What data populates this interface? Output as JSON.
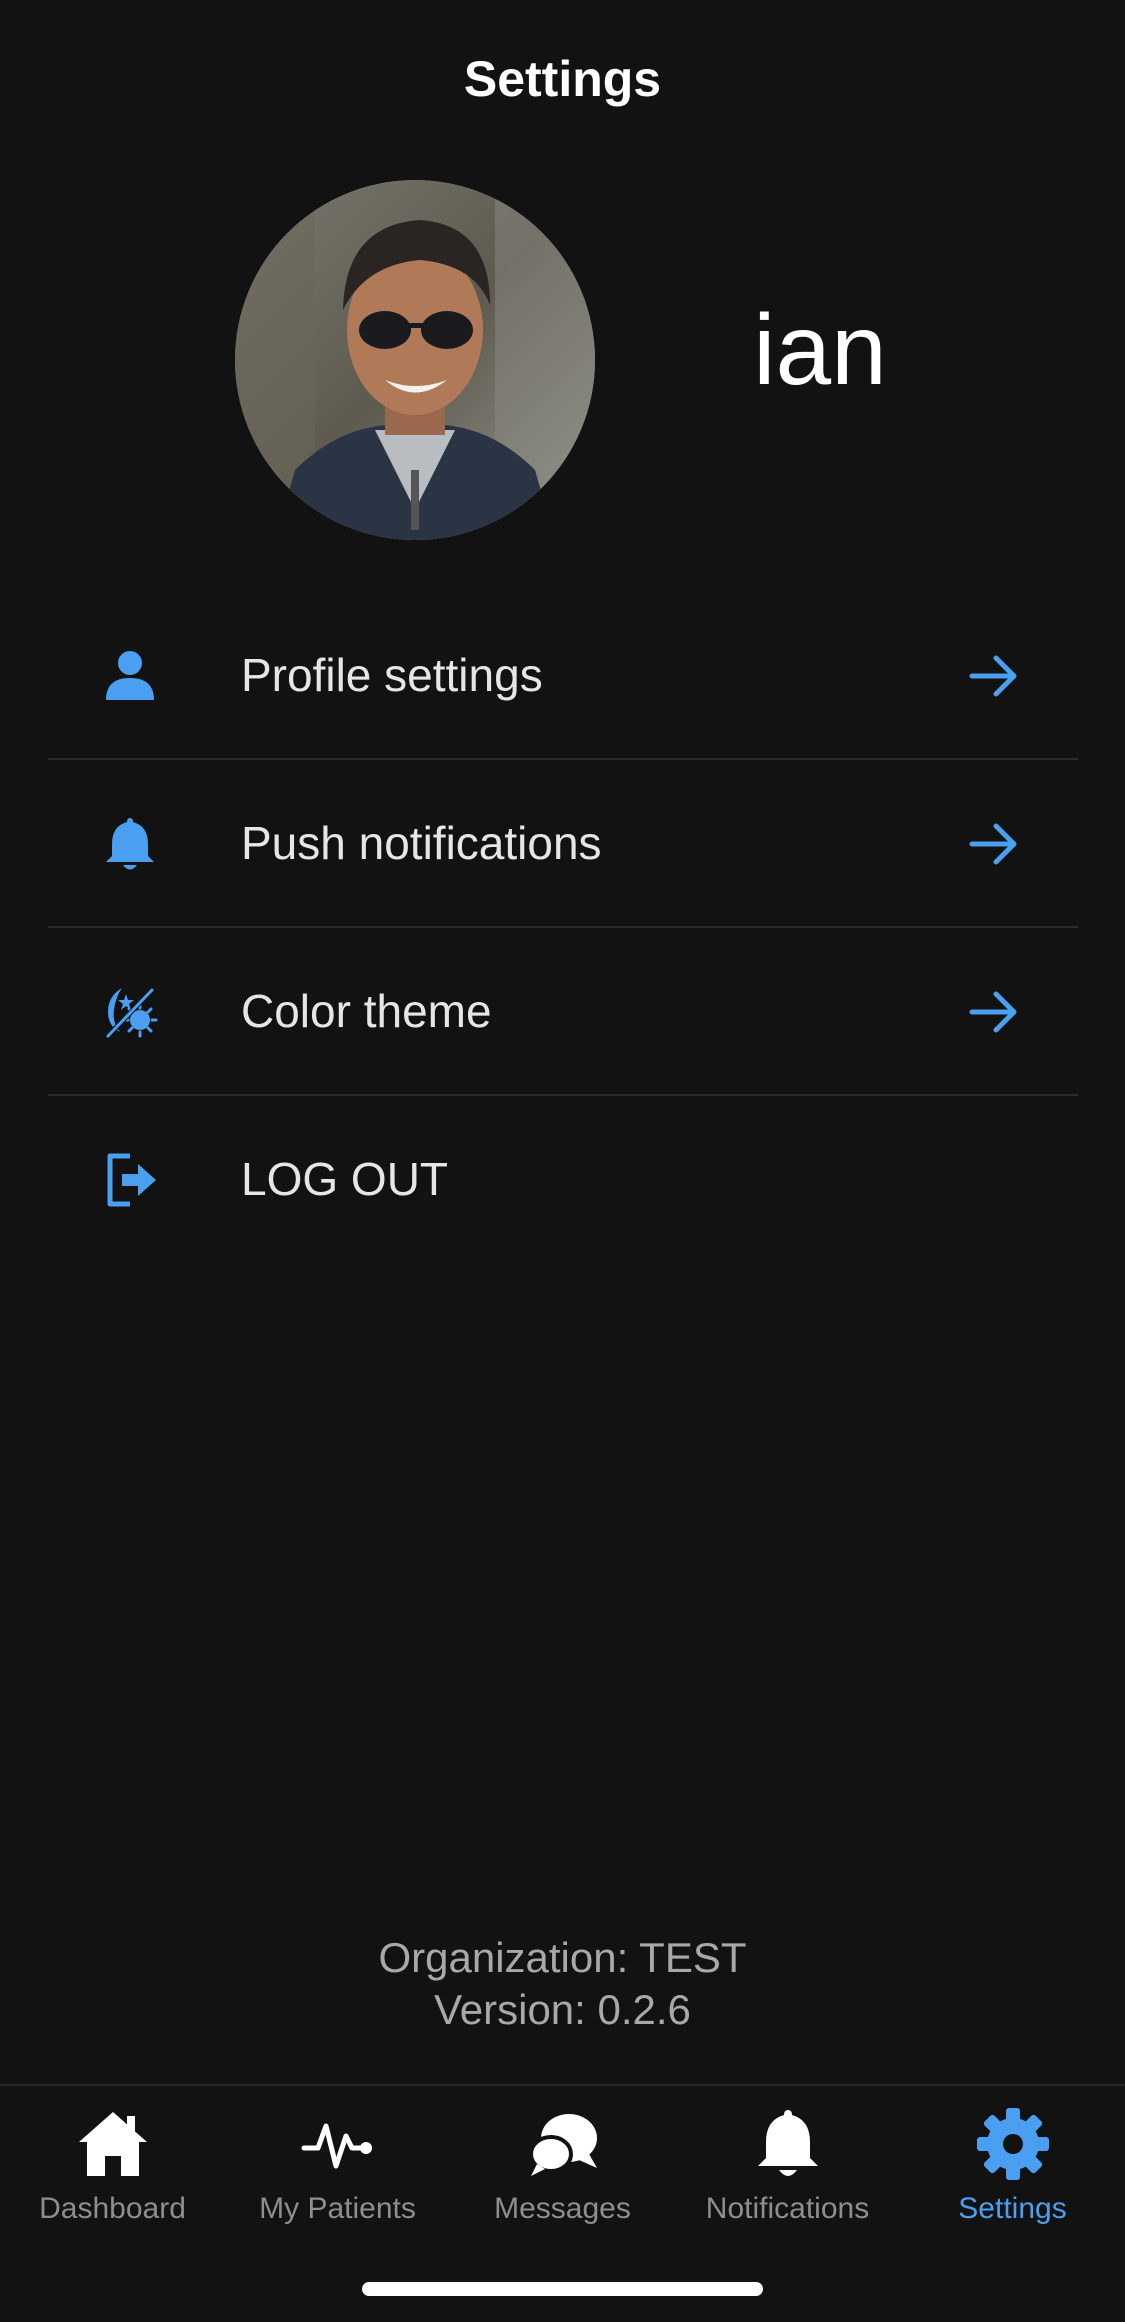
{
  "header": {
    "title": "Settings"
  },
  "profile": {
    "name": "ian"
  },
  "menu": {
    "items": [
      {
        "label": "Profile settings",
        "icon": "person-icon"
      },
      {
        "label": "Push notifications",
        "icon": "bell-icon"
      },
      {
        "label": "Color theme",
        "icon": "theme-icon"
      },
      {
        "label": "LOG OUT",
        "icon": "logout-icon"
      }
    ]
  },
  "footer": {
    "organization": "Organization: TEST",
    "version": "Version: 0.2.6"
  },
  "tabbar": {
    "tabs": [
      {
        "label": "Dashboard",
        "icon": "home-icon",
        "active": false
      },
      {
        "label": "My Patients",
        "icon": "pulse-icon",
        "active": false
      },
      {
        "label": "Messages",
        "icon": "chat-icon",
        "active": false
      },
      {
        "label": "Notifications",
        "icon": "bell-icon",
        "active": false
      },
      {
        "label": "Settings",
        "icon": "gear-icon",
        "active": true
      }
    ]
  },
  "colors": {
    "background": "#121212",
    "accent": "#4a9ff0",
    "text": "#e6e6e6",
    "muted": "#8e8e8e"
  }
}
